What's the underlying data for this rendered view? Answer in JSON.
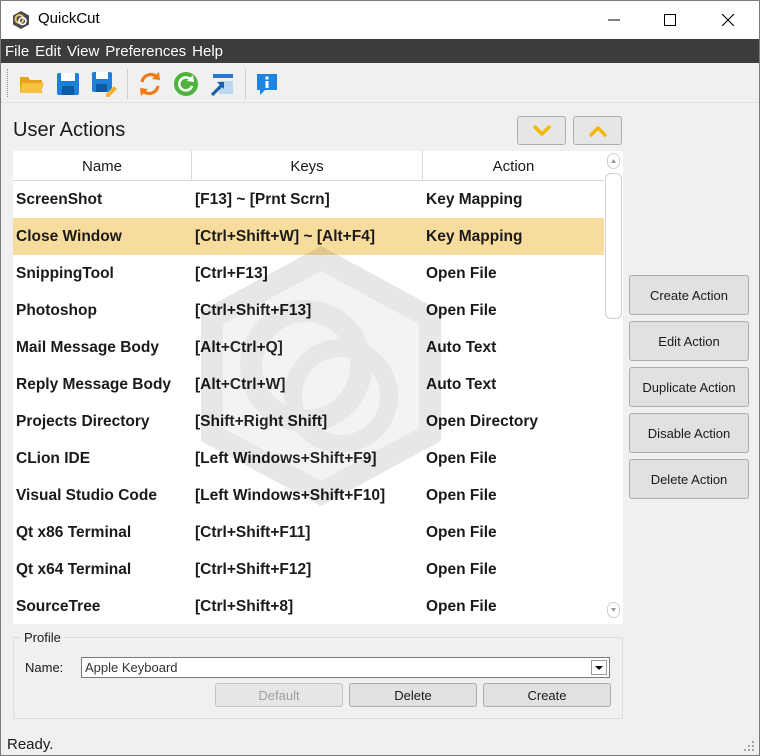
{
  "app": {
    "title": "QuickCut"
  },
  "menu": {
    "items": [
      "File",
      "Edit",
      "View",
      "Preferences",
      "Help"
    ]
  },
  "toolbar": {
    "icons": [
      "open-folder-icon",
      "save-icon",
      "save-as-icon",
      "reload-icon",
      "refresh-icon",
      "export-icon",
      "info-icon"
    ]
  },
  "panel": {
    "title": "User Actions"
  },
  "table": {
    "columns": [
      "Name",
      "Keys",
      "Action"
    ],
    "selected_row": 1,
    "rows": [
      {
        "name": "ScreenShot",
        "keys": "[F13] ~ [Prnt Scrn]",
        "action": "Key Mapping"
      },
      {
        "name": "Close Window",
        "keys": "[Ctrl+Shift+W] ~ [Alt+F4]",
        "action": "Key Mapping"
      },
      {
        "name": "SnippingTool",
        "keys": "[Ctrl+F13]",
        "action": "Open File"
      },
      {
        "name": "Photoshop",
        "keys": "[Ctrl+Shift+F13]",
        "action": "Open File"
      },
      {
        "name": "Mail Message Body",
        "keys": "[Alt+Ctrl+Q]",
        "action": "Auto Text"
      },
      {
        "name": "Reply Message Body",
        "keys": "[Alt+Ctrl+W]",
        "action": "Auto Text"
      },
      {
        "name": "Projects Directory",
        "keys": "[Shift+Right Shift]",
        "action": "Open Directory"
      },
      {
        "name": "CLion IDE",
        "keys": "[Left Windows+Shift+F9]",
        "action": "Open File"
      },
      {
        "name": "Visual Studio Code",
        "keys": "[Left Windows+Shift+F10]",
        "action": "Open File"
      },
      {
        "name": "Qt x86 Terminal",
        "keys": "[Ctrl+Shift+F11]",
        "action": "Open File"
      },
      {
        "name": "Qt x64 Terminal",
        "keys": "[Ctrl+Shift+F12]",
        "action": "Open File"
      },
      {
        "name": "SourceTree",
        "keys": "[Ctrl+Shift+8]",
        "action": "Open File"
      }
    ]
  },
  "side_buttons": {
    "create": "Create Action",
    "edit": "Edit Action",
    "duplicate": "Duplicate Action",
    "disable": "Disable Action",
    "delete": "Delete Action"
  },
  "profile": {
    "group_title": "Profile",
    "name_label": "Name:",
    "selected": "Apple Keyboard",
    "buttons": {
      "default": "Default",
      "delete": "Delete",
      "create": "Create"
    }
  },
  "status": {
    "text": "Ready."
  },
  "colors": {
    "selected_row": "#f8dc9e",
    "menubar": "#3c3c3c",
    "arrow_accent": "#f5b800"
  }
}
